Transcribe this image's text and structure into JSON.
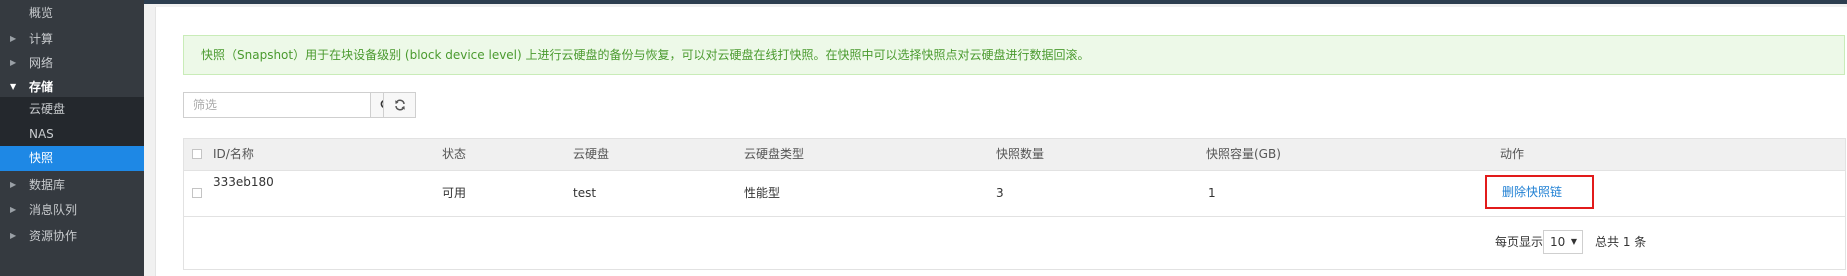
{
  "sidebar": {
    "items": [
      {
        "label": "概览",
        "caret": ""
      },
      {
        "label": "计算",
        "caret": "▶"
      },
      {
        "label": "网络",
        "caret": "▶"
      },
      {
        "label": "存储",
        "caret": "▼"
      },
      {
        "label": "云硬盘",
        "caret": ""
      },
      {
        "label": "NAS",
        "caret": ""
      },
      {
        "label": "快照",
        "caret": ""
      },
      {
        "label": "数据库",
        "caret": "▶"
      },
      {
        "label": "消息队列",
        "caret": "▶"
      },
      {
        "label": "资源协作",
        "caret": "▶"
      }
    ]
  },
  "alert": {
    "text": "快照（Snapshot）用于在块设备级别 (block device level) 上进行云硬盘的备份与恢复，可以对云硬盘在线打快照。在快照中可以选择快照点对云硬盘进行数据回滚。"
  },
  "search": {
    "placeholder": "筛选"
  },
  "table": {
    "columns": [
      "ID/名称",
      "状态",
      "云硬盘",
      "云硬盘类型",
      "快照数量",
      "快照容量(GB)",
      "动作"
    ],
    "rows": [
      {
        "id": "333eb180",
        "status": "可用",
        "disk": "test",
        "disk_type": "性能型",
        "count": "3",
        "size": "1",
        "action": "删除快照链"
      }
    ]
  },
  "pager": {
    "label": "每页显示",
    "page_size": "10",
    "total": "总共 1 条"
  },
  "colors": {
    "sidebar_bg": "#353a40",
    "active_item": "#1e88e5",
    "alert_bg": "#edf9e8",
    "alert_text": "#4a9a2e",
    "link": "#1e7fd3",
    "highlight_border": "#e21b1b"
  }
}
